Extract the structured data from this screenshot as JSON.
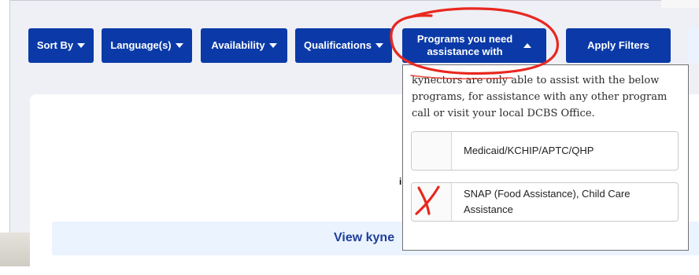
{
  "filters": {
    "sort_by": "Sort By",
    "languages": "Language(s)",
    "availability": "Availability",
    "qualifications": "Qualifications",
    "programs_line1": "Programs you need",
    "programs_line2": "assistance with",
    "apply": "Apply Filters"
  },
  "dropdown": {
    "description": "kynectors are only able to assist with the below programs, for assistance with any other program call or visit your local DCBS Office.",
    "options": [
      {
        "label": "Medicaid/KCHIP/APTC/QHP"
      },
      {
        "label": "SNAP (Food Assistance), Child Care Assistance"
      }
    ]
  },
  "main": {
    "view_button_partial": "View kyne"
  },
  "colors": {
    "brand_blue": "#0b3aa8",
    "annotation_red": "#e8281f",
    "panel_bg": "#eef0f6"
  }
}
